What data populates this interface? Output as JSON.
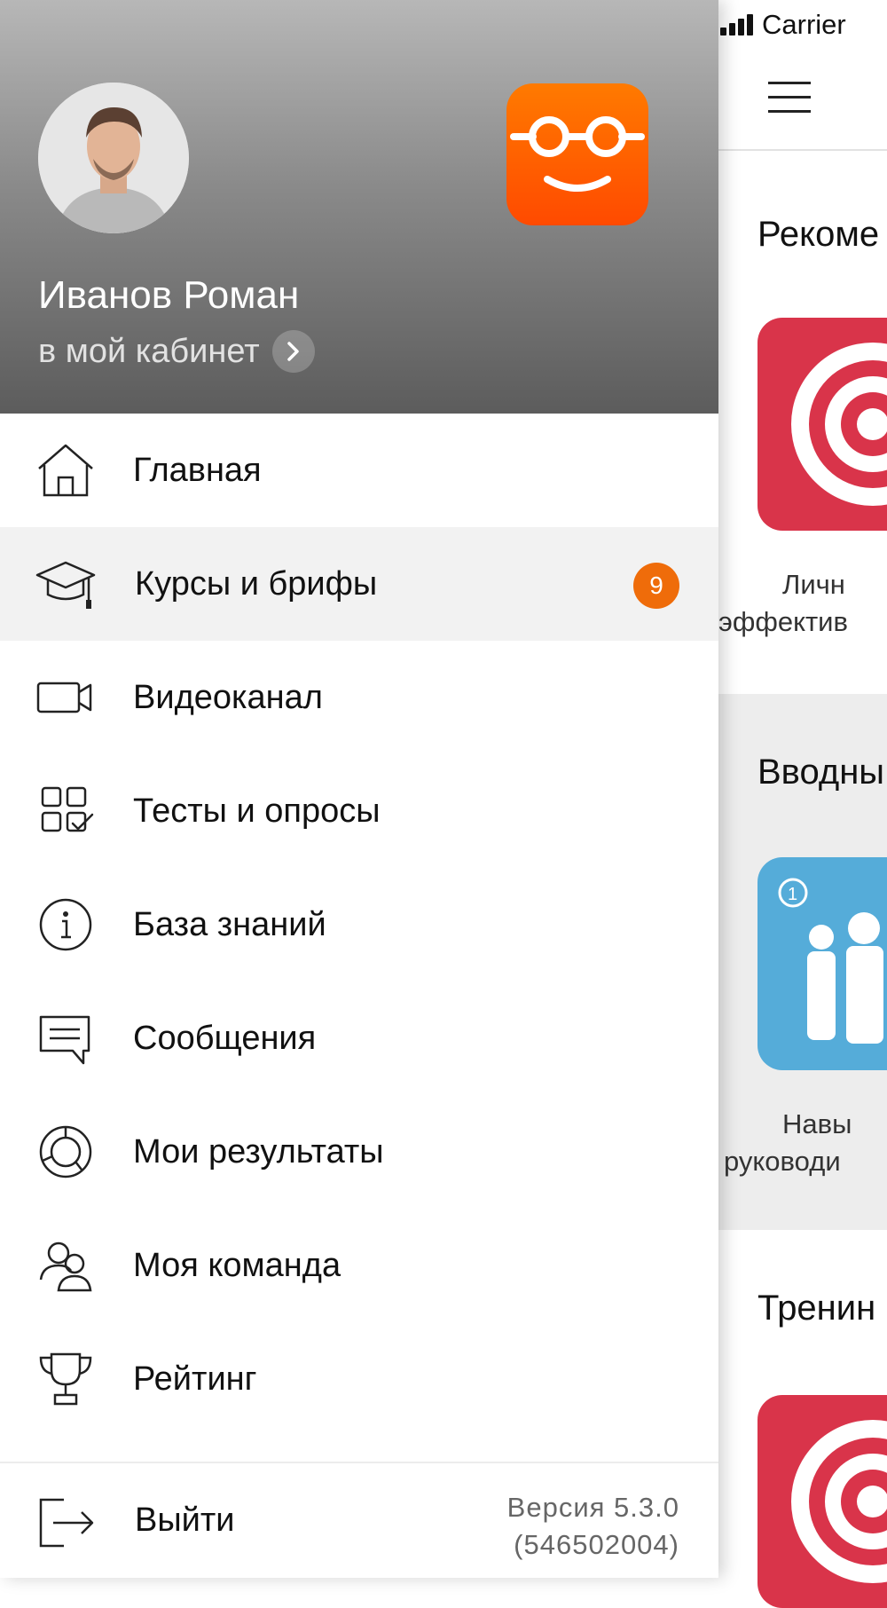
{
  "status_bar": {
    "carrier": "Carrier"
  },
  "background": {
    "sections": [
      {
        "title": "Рекоме",
        "caption_lines": [
          "Личн",
          "эффектив"
        ]
      },
      {
        "title": "Вводны",
        "caption_lines": [
          "Навы",
          "руководи"
        ]
      },
      {
        "title": "Тренин"
      }
    ]
  },
  "drawer": {
    "user_name": "Иванов Роман",
    "cabinet_link": "в мой кабинет",
    "menu": [
      {
        "label": "Главная",
        "icon": "home-icon"
      },
      {
        "label": "Курсы и брифы",
        "icon": "graduation-cap-icon",
        "badge": "9",
        "active": true
      },
      {
        "label": "Видеоканал",
        "icon": "video-camera-icon"
      },
      {
        "label": "Тесты и опросы",
        "icon": "tests-grid-icon"
      },
      {
        "label": "База знаний",
        "icon": "info-icon"
      },
      {
        "label": "Сообщения",
        "icon": "message-icon"
      },
      {
        "label": "Мои результаты",
        "icon": "results-chart-icon"
      },
      {
        "label": "Моя команда",
        "icon": "team-icon"
      },
      {
        "label": "Рейтинг",
        "icon": "trophy-icon"
      }
    ],
    "logout_label": "Выйти",
    "version_line1": "Версия 5.3.0",
    "version_line2": "(546502004)"
  },
  "colors": {
    "accent": "#ef6c0a",
    "logo_orange": "#ff5a00",
    "tile_red": "#d9344a",
    "tile_blue": "#55acd9"
  }
}
